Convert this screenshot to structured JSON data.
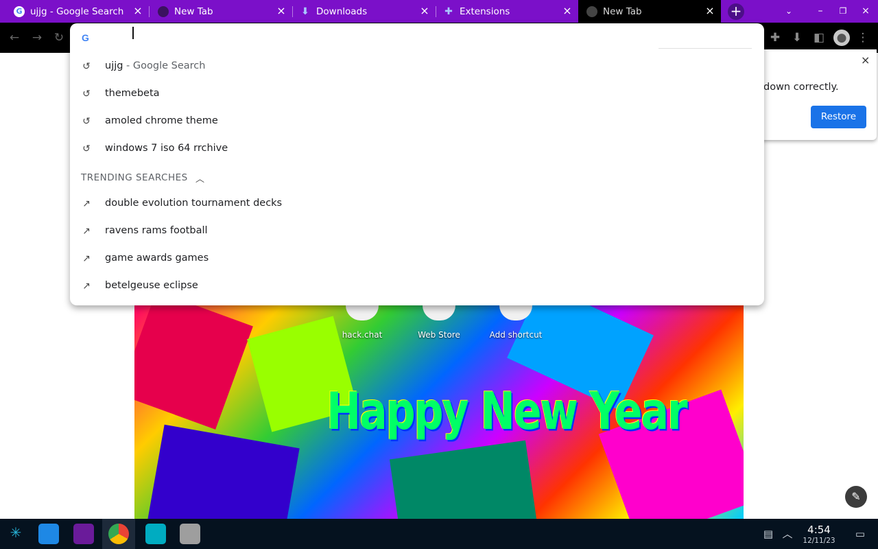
{
  "tabs": [
    {
      "title": "ujjg - Google Search",
      "favicon": "google-g-icon",
      "active": false
    },
    {
      "title": "New Tab",
      "favicon": "chrome-icon",
      "active": false
    },
    {
      "title": "Downloads",
      "favicon": "download-icon",
      "active": false
    },
    {
      "title": "Extensions",
      "favicon": "puzzle-icon",
      "active": false
    },
    {
      "title": "New Tab",
      "favicon": "chrome-icon",
      "active": true
    }
  ],
  "omnibox": {
    "input_value": "",
    "suggestions": [
      {
        "text": "ujjg",
        "suffix": " - Google Search",
        "icon": "history-icon"
      },
      {
        "text": "themebeta",
        "suffix": "",
        "icon": "history-icon"
      },
      {
        "text": "amoled chrome theme",
        "suffix": "",
        "icon": "history-icon"
      },
      {
        "text": "windows 7 iso 64 rrchive",
        "suffix": "",
        "icon": "history-icon"
      }
    ],
    "trending_header": "TRENDING SEARCHES",
    "trending": [
      {
        "text": "double evolution tournament decks",
        "icon": "trending-icon"
      },
      {
        "text": "ravens rams football",
        "icon": "trending-icon"
      },
      {
        "text": "game awards games",
        "icon": "trending-icon"
      },
      {
        "text": "betelgeuse eclipse",
        "icon": "trending-icon"
      }
    ]
  },
  "restore_popup": {
    "message": "down correctly.",
    "button_label": "Restore"
  },
  "shortcuts": [
    {
      "label": "hack.chat"
    },
    {
      "label": "Web Store"
    },
    {
      "label": "Add shortcut"
    }
  ],
  "wallpaper_text": "Happy New Year",
  "taskbar": {
    "time": "4:54",
    "date": "12/11/23"
  },
  "colors": {
    "tabstrip": "#7b10c9",
    "active_tab": "#000000",
    "restore_button": "#1a73e8",
    "taskbar": "#05121f"
  }
}
